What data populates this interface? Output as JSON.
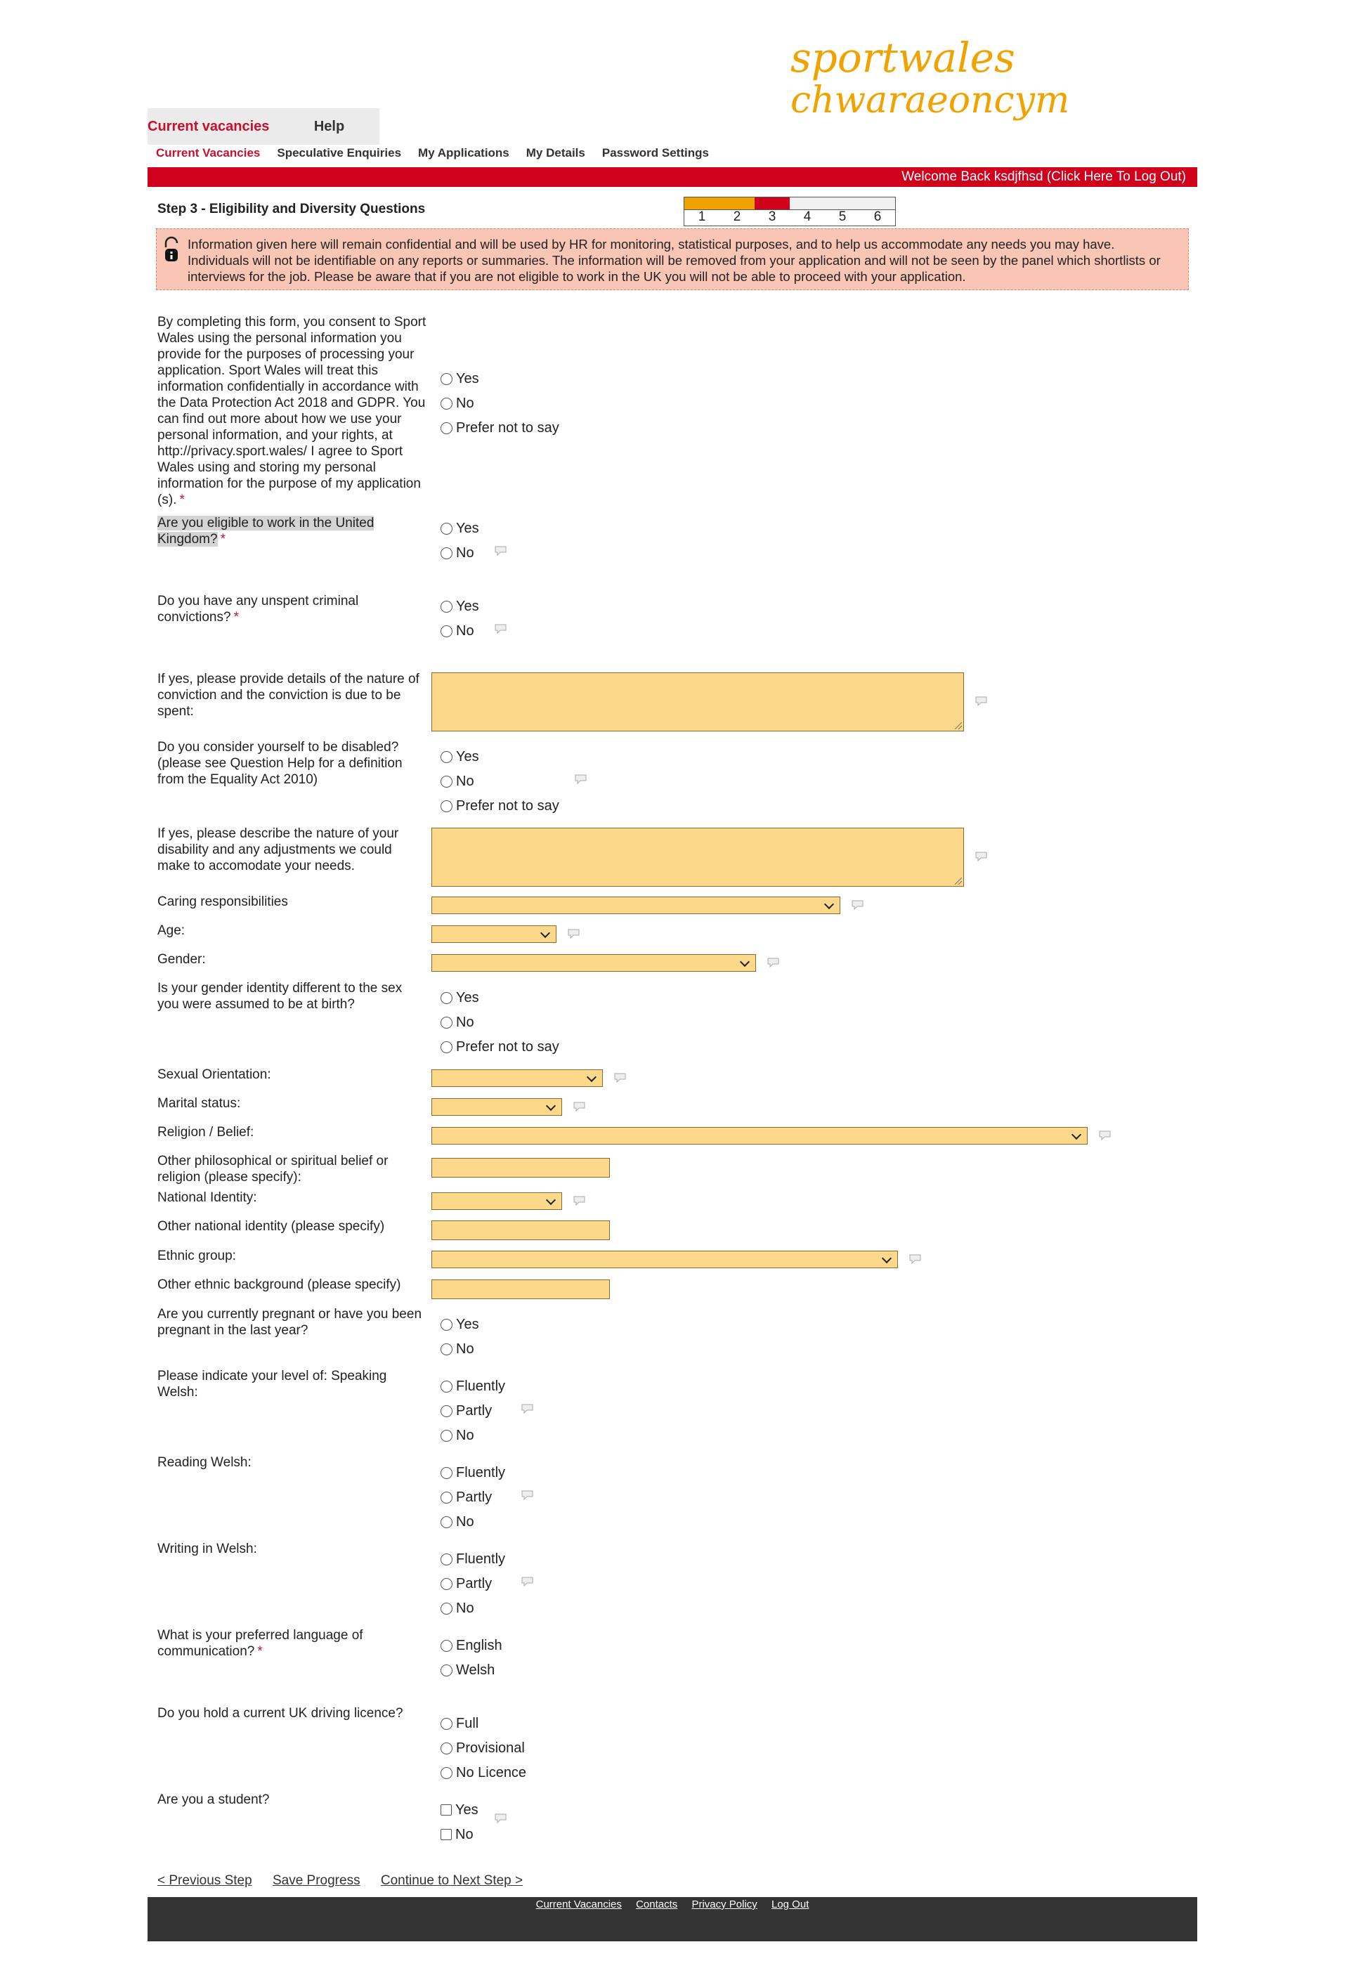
{
  "brand": {
    "logo_line1": "sportwales",
    "logo_line2": "chwaraeoncymru",
    "color_red": "#c8102e",
    "color_orange": "#f0a300"
  },
  "tabs": [
    {
      "label": "Current vacancies",
      "active": true
    },
    {
      "label": "Help",
      "active": false
    }
  ],
  "subnav": [
    {
      "label": "Current Vacancies",
      "active": true
    },
    {
      "label": "Speculative Enquiries"
    },
    {
      "label": "My Applications"
    },
    {
      "label": "My Details"
    },
    {
      "label": "Password Settings"
    }
  ],
  "welcome": "Welcome Back ksdjfhsd  (Click Here To Log Out)",
  "step": {
    "title": "Step 3 - Eligibility and Diversity Questions",
    "progress_steps": [
      "1",
      "2",
      "3",
      "4",
      "5",
      "6"
    ],
    "current_step": 3
  },
  "info_text": "Information given here will remain confidential and will be used by HR for monitoring, statistical purposes, and to help us accommodate any needs you may have. Individuals will not be identifiable on any reports or summaries. The information will be removed from your application and will not be seen by the panel which shortlists or interviews for the job.  Please be aware that if you are not eligible to work in the UK you will not be able to proceed with your application.",
  "questions": {
    "consent": "By completing this form, you consent to Sport Wales using the personal information you provide for the purposes of processing your application. Sport Wales will treat this information confidentially in accordance with the Data Protection Act 2018 and GDPR. You can find out more about how we use your personal information, and your rights, at http://privacy.sport.wales/ I agree to Sport Wales using and storing my personal information for the purpose of my application (s).",
    "eligible": "Are you eligible to work in the United Kingdom?",
    "convictions": "Do you have any unspent criminal convictions?",
    "conviction_details": "If yes, please provide details of the nature of conviction and the conviction is due to be spent:",
    "disabled": "Do you consider yourself to be disabled? (please see Question Help for a definition from the Equality Act 2010)",
    "disability_details": "If yes, please describe the nature of your disability and any adjustments we could make to accomodate your needs.",
    "caring": "Caring responsibilities",
    "age": "Age:",
    "gender": "Gender:",
    "gender_identity": "Is your gender identity different to the sex you were assumed to be at birth?",
    "sexual_orientation": "Sexual Orientation:",
    "marital": "Marital status:",
    "religion": "Religion / Belief:",
    "other_religion": "Other philosophical or spiritual belief or religion (please specify):",
    "national_identity": "National Identity:",
    "other_national": "Other national identity (please specify)",
    "ethnic": "Ethnic group:",
    "other_ethnic": "Other ethnic background (please specify)",
    "pregnant": "Are you currently pregnant or have you been pregnant in the last year?",
    "speaking_welsh": "Please indicate your level of: Speaking Welsh:",
    "reading_welsh": "Reading Welsh:",
    "writing_welsh": "Writing in Welsh:",
    "language": "What is your preferred language of communication?",
    "driving": "Do you hold a current UK driving licence?",
    "student": "Are you a student?"
  },
  "options": {
    "yes": "Yes",
    "no": "No",
    "prefer_not": "Prefer not to say",
    "fluently": "Fluently",
    "partly": "Partly",
    "english": "English",
    "welsh": "Welsh",
    "full": "Full",
    "provisional": "Provisional",
    "no_licence": "No Licence"
  },
  "required_mark": "*",
  "nav": {
    "previous": "< Previous Step",
    "save": "Save Progress",
    "continue": "Continue to Next Step >"
  },
  "footer": [
    "Current Vacancies",
    "Contacts",
    "Privacy Policy",
    "Log Out"
  ]
}
